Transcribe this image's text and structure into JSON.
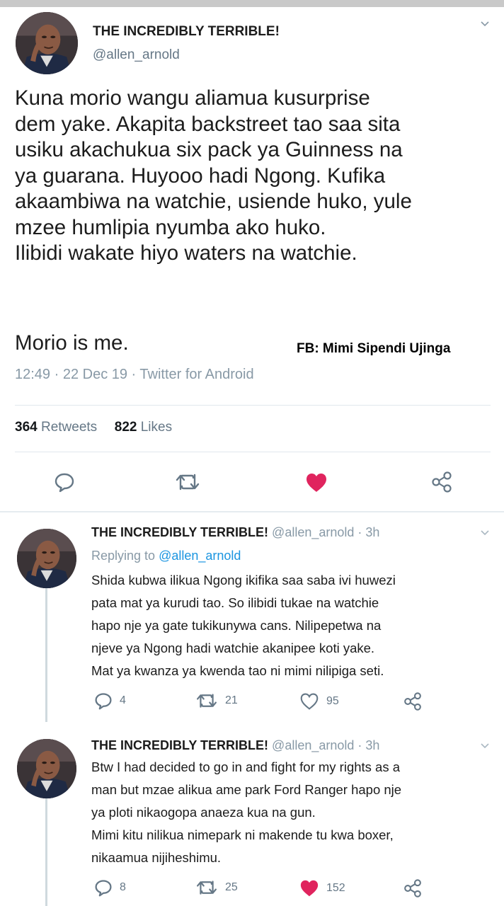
{
  "main_tweet": {
    "name": "THE INCREDIBLY TERRIBLE!",
    "handle": "@allen_arnold",
    "body_lines": [
      "Kuna morio wangu aliamua kusurprise",
      "dem yake. Akapita backstreet tao saa sita",
      "usiku akachukua six pack ya Guinness na",
      "ya guarana. Huyooo hadi Ngong. Kufika",
      "akaambiwa na watchie, usiende huko, yule",
      "mzee humlipia nyumba ako huko.",
      "Ilibidi wakate hiyo waters na watchie."
    ],
    "last_line": "Morio is me.",
    "watermark": "FB: Mimi Sipendi Ujinga",
    "meta": "12:49 · 22 Dec 19 · Twitter for Android",
    "retweets_count": "364",
    "retweets_label": "Retweets",
    "likes_count": "822",
    "likes_label": "Likes",
    "like_color": "#e0245e",
    "actions": [
      "reply-icon",
      "retweet-icon",
      "heart-icon",
      "share-icon"
    ]
  },
  "replies": [
    {
      "name": "THE INCREDIBLY TERRIBLE!",
      "meta": "@allen_arnold · 3h",
      "replying_prefix": "Replying to",
      "replying_to": "@allen_arnold",
      "body_lines": [
        "Shida kubwa ilikua Ngong ikifika saa saba ivi huwezi",
        "pata mat ya kurudi tao. So ilibidi tukae na watchie",
        "hapo nje ya gate tukikunywa cans. Nilipepetwa na",
        "njeve ya Ngong hadi watchie akanipee koti yake.",
        "Mat ya kwanza ya kwenda tao ni mimi nilipiga seti."
      ],
      "replies": "4",
      "retweets": "21",
      "likes": "95",
      "liked": false
    },
    {
      "name": "THE INCREDIBLY TERRIBLE!",
      "meta": "@allen_arnold · 3h",
      "body_lines": [
        "Btw I had decided to go in and fight for my rights as a",
        "man but mzae alikua ame park Ford Ranger hapo nje",
        "ya ploti nikaogopa anaeza kua na gun.",
        "Mimi kitu nilikua nimepark ni makende tu kwa boxer,",
        "nikaamua nijiheshimu."
      ],
      "replies": "8",
      "retweets": "25",
      "likes": "152",
      "liked": true
    }
  ]
}
